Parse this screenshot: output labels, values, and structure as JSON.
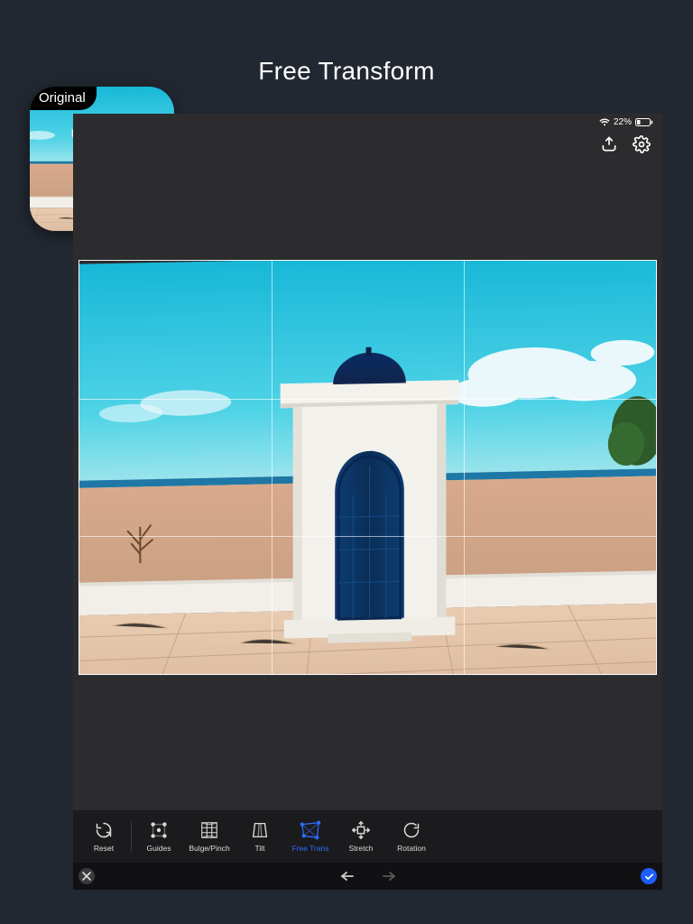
{
  "page_title": "Free Transform",
  "thumbnail": {
    "badge": "Original"
  },
  "status": {
    "battery_text": "22%"
  },
  "tools": [
    {
      "key": "reset",
      "label": "Reset"
    },
    {
      "key": "guides",
      "label": "Guides"
    },
    {
      "key": "bulge",
      "label": "Bulge/Pinch"
    },
    {
      "key": "tilt",
      "label": "Tilt"
    },
    {
      "key": "freetrans",
      "label": "Free Trans",
      "active": true
    },
    {
      "key": "stretch",
      "label": "Stretch"
    },
    {
      "key": "rotation",
      "label": "Rotation"
    }
  ],
  "colors": {
    "accent": "#2f6bff",
    "bg": "#222831",
    "device_bg": "#2c2c2e",
    "toolrow_bg": "#1b1b1d"
  }
}
